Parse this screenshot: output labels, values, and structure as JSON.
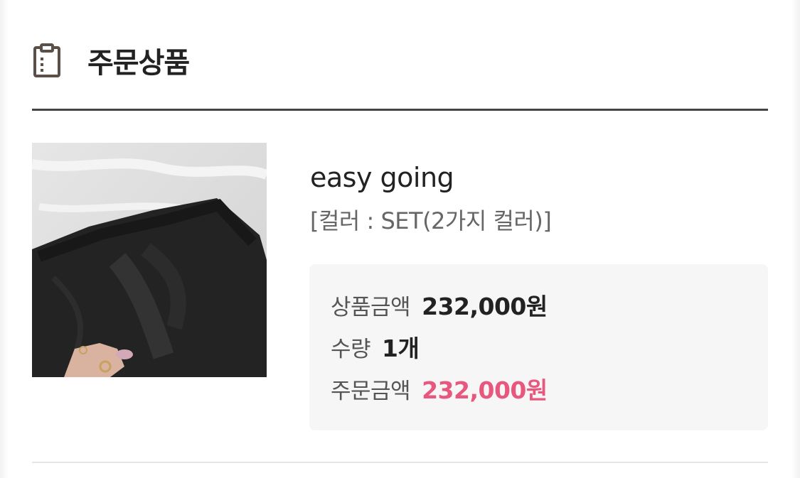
{
  "section": {
    "icon": "clipboard-icon",
    "title": "주문상품"
  },
  "product": {
    "name": "easy going",
    "option": "[컬러 : SET(2가지 컬러)]",
    "image_alt": "black pants product photo"
  },
  "price": {
    "product_amount_label": "상품금액",
    "product_amount_value": "232,000원",
    "quantity_label": "수량",
    "quantity_value": "1개",
    "order_amount_label": "주문금액",
    "order_amount_value": "232,000원"
  },
  "colors": {
    "accent": "#e8577e",
    "rule": "#444444",
    "box_bg": "#f6f6f6"
  }
}
